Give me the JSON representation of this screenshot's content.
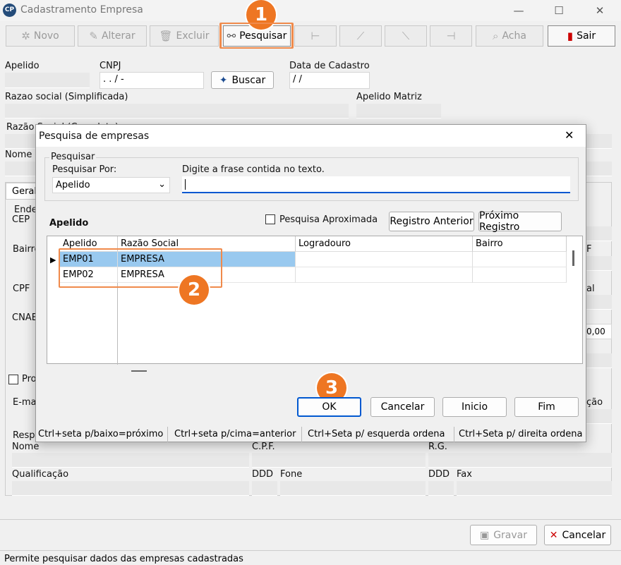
{
  "app": {
    "title": "Cadastramento Empresa",
    "icon_text": "CP"
  },
  "toolbar": {
    "novo": "Novo",
    "alterar": "Alterar",
    "excluir": "Excluir",
    "pesquisar": "Pesquisar",
    "acha": "Acha",
    "sair": "Sair"
  },
  "form": {
    "apelido_label": "Apelido",
    "cnpj_label": "CNPJ",
    "cnpj_value": "  .   .   /    -",
    "buscar": "Buscar",
    "data_cadastro_label": "Data de Cadastro",
    "data_cadastro_value": "/ /",
    "razao_simplificada_label": "Razao social (Simplificada)",
    "apelido_matriz_label": "Apelido Matriz",
    "razao_completa_label": "Razão Social (Completa)",
    "nome_fantasia_label": "Nome F",
    "tab_geral": "Geral",
    "endereco_label": "Ende",
    "cep_label": "CEP",
    "bairro_label": "Bairro",
    "cpf_label": "CPF",
    "cnae_label": "CNAE",
    "valor": "0,00",
    "pro_label": "Pro",
    "email_label": "E-ma",
    "resp_label": "Resp",
    "nome_label": "Nome",
    "cpf2_label": "C.P.F.",
    "rg_label": "R.G.",
    "qualificacao_label": "Qualificação",
    "ddd1_label": "DDD",
    "fone_label": "Fone",
    "ddd2_label": "DDD",
    "fax_label": "Fax",
    "right_f": "F",
    "right_al": "al",
    "right_cao": "ção"
  },
  "bottom": {
    "gravar": "Gravar",
    "cancelar": "Cancelar"
  },
  "status": "Permite pesquisar dados das empresas cadastradas",
  "dialog": {
    "title": "Pesquisa de empresas",
    "group_label": "Pesquisar",
    "search_by_label": "Pesquisar Por:",
    "search_by_value": "Apelido",
    "phrase_label": "Digite a frase contida no texto.",
    "phrase_value": "",
    "section_label": "Apelido",
    "approx_label": "Pesquisa Aproximada",
    "prev_button": "Registro Anterior",
    "next_button": "Próximo Registro",
    "columns": [
      "Apelido",
      "Razão Social",
      "Logradouro",
      "Bairro"
    ],
    "rows": [
      {
        "apelido": "EMP01",
        "razao": "EMPRESA",
        "logradouro": "",
        "bairro": ""
      },
      {
        "apelido": "EMP02",
        "razao": "EMPRESA",
        "logradouro": "",
        "bairro": ""
      }
    ],
    "ok": "OK",
    "cancelar": "Cancelar",
    "inicio": "Inicio",
    "fim": "Fim",
    "hints": [
      "Ctrl+seta p/baixo=próximo",
      "Ctrl+seta p/cima=anterior",
      "Ctrl+Seta p/ esquerda ordena",
      "Ctrl+Seta p/ direita ordena"
    ]
  },
  "badges": [
    "1",
    "2",
    "3"
  ],
  "colors": {
    "highlight": "#f08a4b",
    "badge": "#ee7623",
    "selected_row": "#99c9ef"
  }
}
